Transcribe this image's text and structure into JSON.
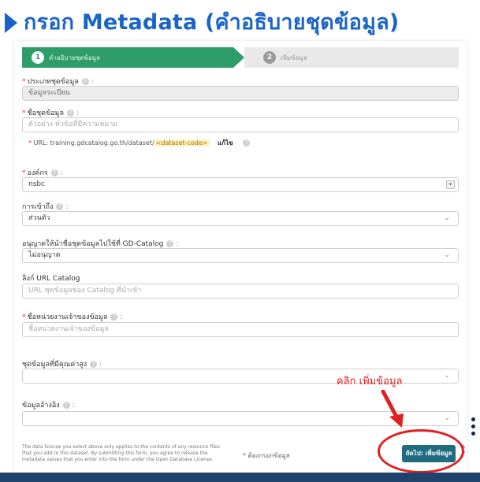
{
  "title": "กรอก Metadata (คำอธิบายชุดข้อมูล)",
  "stepper": {
    "step1_num": "1",
    "step1_label": "คำอธิบายชุดข้อมูล",
    "step2_num": "2",
    "step2_label": "เพิ่มข้อมูล"
  },
  "fields": {
    "dataset_type": {
      "label": "ประเภทชุดข้อมูล",
      "value": "ข้อมูลระเบียน"
    },
    "dataset_name": {
      "label": "ชื่อชุดข้อมูล",
      "placeholder": "ตัวอย่าง หัวข้อที่มีความหมาย"
    },
    "url": {
      "prefix": "URL: training.gdcatalog.go.th/dataset/",
      "slug": "<dataset-code>",
      "edit_label": "แก้ไข"
    },
    "organization": {
      "label": "องค์กร",
      "value": "nsbc"
    },
    "access": {
      "label": "การเข้าถึง",
      "value": "ส่วนตัว"
    },
    "gd_catalog": {
      "label": "อนุญาตให้นำชื่อชุดข้อมูลไปใช้ที่ GD-Catalog",
      "value": "ไม่อนุญาต"
    },
    "catalog_url": {
      "label": "ลิงก์ URL Catalog",
      "placeholder": "URL ชุดข้อมูลของ Catalog ที่นำเข้า"
    },
    "agency": {
      "label": "ชื่อหน่วยงานเจ้าของข้อมูล",
      "placeholder": "ชื่อหน่วยงานเจ้าของข้อมูล"
    },
    "high_value": {
      "label": "ชุดข้อมูลที่มีคุณค่าสูง"
    },
    "data_type": {
      "label": "ข้อมูลอ้างอิง"
    }
  },
  "footer": {
    "license_note": "The data license you select above only applies to the contents of any resource files that you add to this dataset. By submitting this form, you agree to release the metadata values that you enter into the form under the Open Database License.",
    "required_note": "* ต้องกรอกข้อมูล",
    "save_label": "ถัดไป: เพิ่มข้อมูล"
  },
  "annotation": {
    "text": "คลิก เพิ่มข้อมูล"
  },
  "colors": {
    "title": "#1a64c8",
    "step_active": "#2e9d68",
    "save_button": "#1f6b80",
    "annotation": "#e02020"
  }
}
